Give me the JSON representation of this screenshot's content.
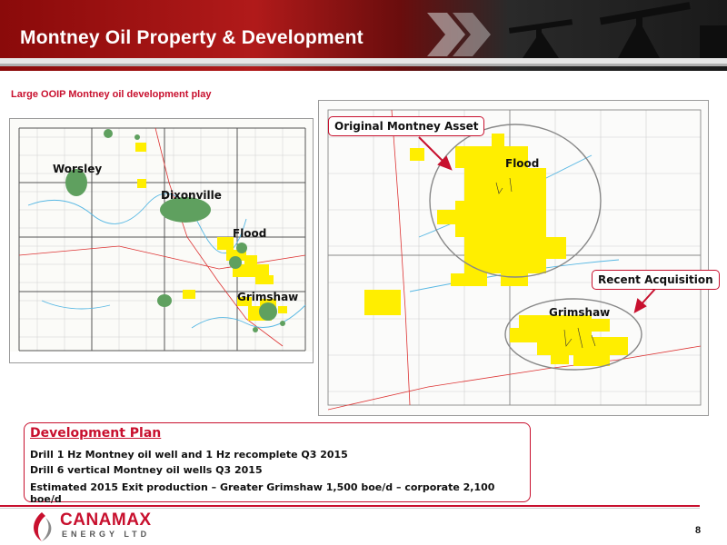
{
  "header": {
    "title": "Montney Oil Property & Development"
  },
  "subtitle": "Large OOIP Montney oil development play",
  "left_map": {
    "labels": {
      "worsley": "Worsley",
      "dixonville": "Dixonville",
      "flood": "Flood",
      "grimshaw": "Grimshaw"
    }
  },
  "right_map": {
    "labels": {
      "flood": "Flood",
      "grimshaw": "Grimshaw"
    },
    "callouts": {
      "original": "Original Montney Asset",
      "recent": "Recent Acquisition"
    }
  },
  "plan": {
    "title": "Development Plan",
    "lines": [
      "Drill 1 Hz Montney oil well and 1 Hz recomplete Q3 2015",
      "Drill 6 vertical Montney oil wells Q3 2015",
      "Estimated 2015 Exit production – Greater Grimshaw 1,500 boe/d – corporate 2,100 boe/d"
    ]
  },
  "footer": {
    "logo_name": "CANAMAX",
    "logo_sub": "ENERGY LTD",
    "page_number": "8"
  },
  "colors": {
    "accent": "#c8102e",
    "land": "#ffee00",
    "wells": "#5fa05f"
  }
}
